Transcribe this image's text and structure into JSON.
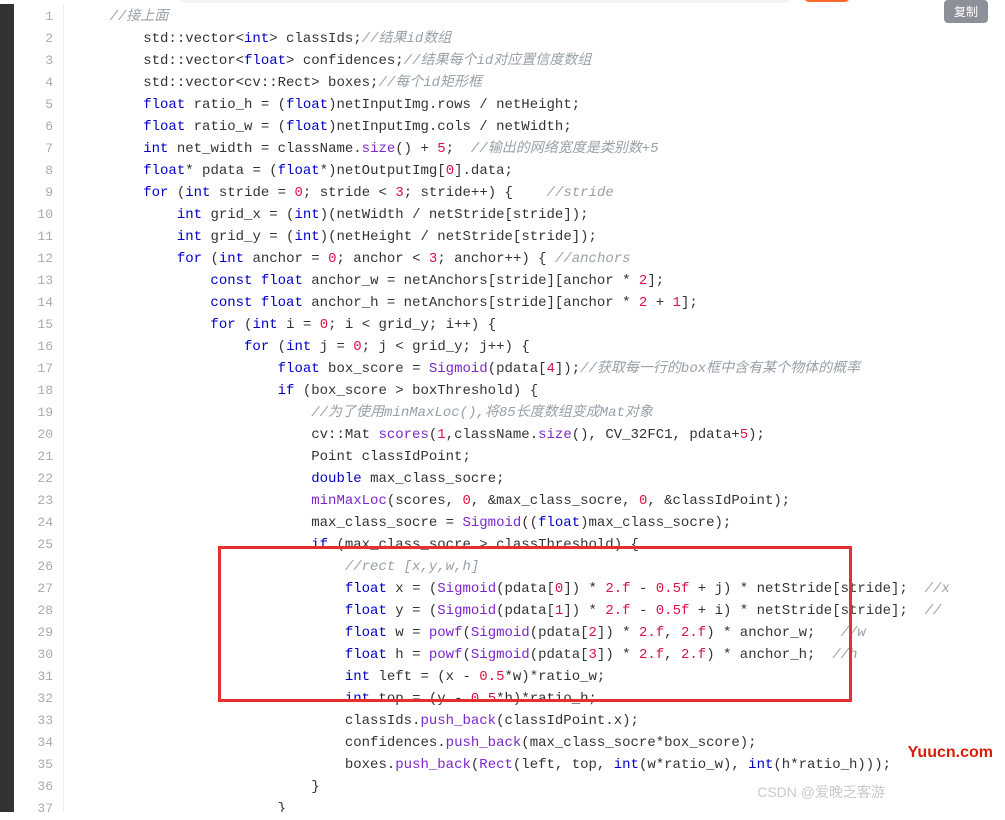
{
  "copy_label": "复制",
  "watermark1": "Yuucn.com",
  "watermark2": "CSDN @爱晚乏客游",
  "lines": [
    {
      "n": 1,
      "ind": 1,
      "tokens": [
        {
          "t": "//接上面",
          "c": "cmt"
        }
      ]
    },
    {
      "n": 2,
      "ind": 2,
      "tokens": [
        {
          "t": "std::vector<"
        },
        {
          "t": "int",
          "c": "kw"
        },
        {
          "t": "> classIds;"
        },
        {
          "t": "//结果id数组",
          "c": "cmt"
        }
      ]
    },
    {
      "n": 3,
      "ind": 2,
      "tokens": [
        {
          "t": "std::vector<"
        },
        {
          "t": "float",
          "c": "kw"
        },
        {
          "t": "> confidences;"
        },
        {
          "t": "//结果每个id对应置信度数组",
          "c": "cmt"
        }
      ]
    },
    {
      "n": 4,
      "ind": 2,
      "tokens": [
        {
          "t": "std::vector<cv::Rect> boxes;"
        },
        {
          "t": "//每个id矩形框",
          "c": "cmt"
        }
      ]
    },
    {
      "n": 5,
      "ind": 2,
      "tokens": [
        {
          "t": "float",
          "c": "kw"
        },
        {
          "t": " ratio_h = ("
        },
        {
          "t": "float",
          "c": "kw"
        },
        {
          "t": ")netInputImg.rows / netHeight;"
        }
      ]
    },
    {
      "n": 6,
      "ind": 2,
      "tokens": [
        {
          "t": "float",
          "c": "kw"
        },
        {
          "t": " ratio_w = ("
        },
        {
          "t": "float",
          "c": "kw"
        },
        {
          "t": ")netInputImg.cols / netWidth;"
        }
      ]
    },
    {
      "n": 7,
      "ind": 2,
      "tokens": [
        {
          "t": "int",
          "c": "kw"
        },
        {
          "t": " net_width = className."
        },
        {
          "t": "size",
          "c": "fn"
        },
        {
          "t": "() + "
        },
        {
          "t": "5",
          "c": "num"
        },
        {
          "t": ";  "
        },
        {
          "t": "//输出的网络宽度是类别数+5",
          "c": "cmt"
        }
      ]
    },
    {
      "n": 8,
      "ind": 2,
      "tokens": [
        {
          "t": "float",
          "c": "kw"
        },
        {
          "t": "* pdata = ("
        },
        {
          "t": "float",
          "c": "kw"
        },
        {
          "t": "*)netOutputImg["
        },
        {
          "t": "0",
          "c": "num"
        },
        {
          "t": "].data;"
        }
      ]
    },
    {
      "n": 9,
      "ind": 2,
      "tokens": [
        {
          "t": "for",
          "c": "kw"
        },
        {
          "t": " ("
        },
        {
          "t": "int",
          "c": "kw"
        },
        {
          "t": " stride = "
        },
        {
          "t": "0",
          "c": "num"
        },
        {
          "t": "; stride < "
        },
        {
          "t": "3",
          "c": "num"
        },
        {
          "t": "; stride++) {    "
        },
        {
          "t": "//stride",
          "c": "cmt"
        }
      ]
    },
    {
      "n": 10,
      "ind": 3,
      "tokens": [
        {
          "t": "int",
          "c": "kw"
        },
        {
          "t": " grid_x = ("
        },
        {
          "t": "int",
          "c": "kw"
        },
        {
          "t": ")(netWidth / netStride[stride]);"
        }
      ]
    },
    {
      "n": 11,
      "ind": 3,
      "tokens": [
        {
          "t": "int",
          "c": "kw"
        },
        {
          "t": " grid_y = ("
        },
        {
          "t": "int",
          "c": "kw"
        },
        {
          "t": ")(netHeight / netStride[stride]);"
        }
      ]
    },
    {
      "n": 12,
      "ind": 3,
      "tokens": [
        {
          "t": "for",
          "c": "kw"
        },
        {
          "t": " ("
        },
        {
          "t": "int",
          "c": "kw"
        },
        {
          "t": " anchor = "
        },
        {
          "t": "0",
          "c": "num"
        },
        {
          "t": "; anchor < "
        },
        {
          "t": "3",
          "c": "num"
        },
        {
          "t": "; anchor++) { "
        },
        {
          "t": "//anchors",
          "c": "cmt"
        }
      ]
    },
    {
      "n": 13,
      "ind": 4,
      "tokens": [
        {
          "t": "const",
          "c": "kw"
        },
        {
          "t": " "
        },
        {
          "t": "float",
          "c": "kw"
        },
        {
          "t": " anchor_w = netAnchors[stride][anchor * "
        },
        {
          "t": "2",
          "c": "num"
        },
        {
          "t": "];"
        }
      ]
    },
    {
      "n": 14,
      "ind": 4,
      "tokens": [
        {
          "t": "const",
          "c": "kw"
        },
        {
          "t": " "
        },
        {
          "t": "float",
          "c": "kw"
        },
        {
          "t": " anchor_h = netAnchors[stride][anchor * "
        },
        {
          "t": "2",
          "c": "num"
        },
        {
          "t": " + "
        },
        {
          "t": "1",
          "c": "num"
        },
        {
          "t": "];"
        }
      ]
    },
    {
      "n": 15,
      "ind": 4,
      "tokens": [
        {
          "t": "for",
          "c": "kw"
        },
        {
          "t": " ("
        },
        {
          "t": "int",
          "c": "kw"
        },
        {
          "t": " i = "
        },
        {
          "t": "0",
          "c": "num"
        },
        {
          "t": "; i < grid_y; i++) {"
        }
      ]
    },
    {
      "n": 16,
      "ind": 5,
      "tokens": [
        {
          "t": "for",
          "c": "kw"
        },
        {
          "t": " ("
        },
        {
          "t": "int",
          "c": "kw"
        },
        {
          "t": " j = "
        },
        {
          "t": "0",
          "c": "num"
        },
        {
          "t": "; j < grid_y; j++) {"
        }
      ]
    },
    {
      "n": 17,
      "ind": 6,
      "tokens": [
        {
          "t": "float",
          "c": "kw"
        },
        {
          "t": " box_score = "
        },
        {
          "t": "Sigmoid",
          "c": "fn"
        },
        {
          "t": "(pdata["
        },
        {
          "t": "4",
          "c": "num"
        },
        {
          "t": "]);"
        },
        {
          "t": "//获取每一行的box框中含有某个物体的概率",
          "c": "cmt"
        }
      ]
    },
    {
      "n": 18,
      "ind": 6,
      "tokens": [
        {
          "t": "if",
          "c": "kw"
        },
        {
          "t": " (box_score > boxThreshold) {"
        }
      ]
    },
    {
      "n": 19,
      "ind": 7,
      "tokens": [
        {
          "t": "//为了使用minMaxLoc(),将85长度数组变成Mat对象",
          "c": "cmt"
        }
      ]
    },
    {
      "n": 20,
      "ind": 7,
      "tokens": [
        {
          "t": "cv::Mat "
        },
        {
          "t": "scores",
          "c": "fn"
        },
        {
          "t": "("
        },
        {
          "t": "1",
          "c": "num"
        },
        {
          "t": ",className."
        },
        {
          "t": "size",
          "c": "fn"
        },
        {
          "t": "(), CV_32FC1, pdata+"
        },
        {
          "t": "5",
          "c": "num"
        },
        {
          "t": ");"
        }
      ]
    },
    {
      "n": 21,
      "ind": 7,
      "tokens": [
        {
          "t": "Point classIdPoint;"
        }
      ]
    },
    {
      "n": 22,
      "ind": 7,
      "tokens": [
        {
          "t": "double",
          "c": "kw"
        },
        {
          "t": " max_class_socre;"
        }
      ]
    },
    {
      "n": 23,
      "ind": 7,
      "tokens": [
        {
          "t": "minMaxLoc",
          "c": "fn"
        },
        {
          "t": "(scores, "
        },
        {
          "t": "0",
          "c": "num"
        },
        {
          "t": ", &max_class_socre, "
        },
        {
          "t": "0",
          "c": "num"
        },
        {
          "t": ", &classIdPoint);"
        }
      ]
    },
    {
      "n": 24,
      "ind": 7,
      "tokens": [
        {
          "t": "max_class_socre = "
        },
        {
          "t": "Sigmoid",
          "c": "fn"
        },
        {
          "t": "(("
        },
        {
          "t": "float",
          "c": "kw"
        },
        {
          "t": ")max_class_socre);"
        }
      ]
    },
    {
      "n": 25,
      "ind": 7,
      "tokens": [
        {
          "t": "if",
          "c": "kw"
        },
        {
          "t": " (max_class_socre > classThreshold) {"
        }
      ]
    },
    {
      "n": 26,
      "ind": 8,
      "tokens": [
        {
          "t": "//rect [x,y,w,h]",
          "c": "cmt"
        }
      ]
    },
    {
      "n": 27,
      "ind": 8,
      "tokens": [
        {
          "t": "float",
          "c": "kw"
        },
        {
          "t": " x = ("
        },
        {
          "t": "Sigmoid",
          "c": "fn"
        },
        {
          "t": "(pdata["
        },
        {
          "t": "0",
          "c": "num"
        },
        {
          "t": "]) * "
        },
        {
          "t": "2.f",
          "c": "num"
        },
        {
          "t": " - "
        },
        {
          "t": "0.5f",
          "c": "num"
        },
        {
          "t": " + j) * netStride[stride];  "
        },
        {
          "t": "//x",
          "c": "cmt"
        }
      ]
    },
    {
      "n": 28,
      "ind": 8,
      "tokens": [
        {
          "t": "float",
          "c": "kw"
        },
        {
          "t": " y = ("
        },
        {
          "t": "Sigmoid",
          "c": "fn"
        },
        {
          "t": "(pdata["
        },
        {
          "t": "1",
          "c": "num"
        },
        {
          "t": "]) * "
        },
        {
          "t": "2.f",
          "c": "num"
        },
        {
          "t": " - "
        },
        {
          "t": "0.5f",
          "c": "num"
        },
        {
          "t": " + i) * netStride[stride];  "
        },
        {
          "t": "//",
          "c": "cmt"
        }
      ]
    },
    {
      "n": 29,
      "ind": 8,
      "tokens": [
        {
          "t": "float",
          "c": "kw"
        },
        {
          "t": " w = "
        },
        {
          "t": "powf",
          "c": "fn"
        },
        {
          "t": "("
        },
        {
          "t": "Sigmoid",
          "c": "fn"
        },
        {
          "t": "(pdata["
        },
        {
          "t": "2",
          "c": "num"
        },
        {
          "t": "]) * "
        },
        {
          "t": "2.f",
          "c": "num"
        },
        {
          "t": ", "
        },
        {
          "t": "2.f",
          "c": "num"
        },
        {
          "t": ") * anchor_w;   "
        },
        {
          "t": "//w",
          "c": "cmt"
        }
      ]
    },
    {
      "n": 30,
      "ind": 8,
      "tokens": [
        {
          "t": "float",
          "c": "kw"
        },
        {
          "t": " h = "
        },
        {
          "t": "powf",
          "c": "fn"
        },
        {
          "t": "("
        },
        {
          "t": "Sigmoid",
          "c": "fn"
        },
        {
          "t": "(pdata["
        },
        {
          "t": "3",
          "c": "num"
        },
        {
          "t": "]) * "
        },
        {
          "t": "2.f",
          "c": "num"
        },
        {
          "t": ", "
        },
        {
          "t": "2.f",
          "c": "num"
        },
        {
          "t": ") * anchor_h;  "
        },
        {
          "t": "//h",
          "c": "cmt"
        }
      ]
    },
    {
      "n": 31,
      "ind": 8,
      "tokens": [
        {
          "t": "int",
          "c": "kw"
        },
        {
          "t": " left = (x - "
        },
        {
          "t": "0.5",
          "c": "num"
        },
        {
          "t": "*w)*ratio_w;"
        }
      ]
    },
    {
      "n": 32,
      "ind": 8,
      "tokens": [
        {
          "t": "int",
          "c": "kw"
        },
        {
          "t": " top = (y - "
        },
        {
          "t": "0.5",
          "c": "num"
        },
        {
          "t": "*h)*ratio_h;"
        }
      ]
    },
    {
      "n": 33,
      "ind": 8,
      "tokens": [
        {
          "t": "classIds."
        },
        {
          "t": "push_back",
          "c": "fn"
        },
        {
          "t": "(classIdPoint.x);"
        }
      ]
    },
    {
      "n": 34,
      "ind": 8,
      "tokens": [
        {
          "t": "confidences."
        },
        {
          "t": "push_back",
          "c": "fn"
        },
        {
          "t": "(max_class_socre*box_score);"
        }
      ]
    },
    {
      "n": 35,
      "ind": 8,
      "tokens": [
        {
          "t": "boxes."
        },
        {
          "t": "push_back",
          "c": "fn"
        },
        {
          "t": "("
        },
        {
          "t": "Rect",
          "c": "fn"
        },
        {
          "t": "(left, top, "
        },
        {
          "t": "int",
          "c": "kw"
        },
        {
          "t": "(w*ratio_w), "
        },
        {
          "t": "int",
          "c": "kw"
        },
        {
          "t": "(h*ratio_h)));"
        }
      ]
    },
    {
      "n": 36,
      "ind": 7,
      "tokens": [
        {
          "t": "}"
        }
      ]
    },
    {
      "n": 37,
      "ind": 6,
      "tokens": [
        {
          "t": "}"
        }
      ]
    }
  ]
}
